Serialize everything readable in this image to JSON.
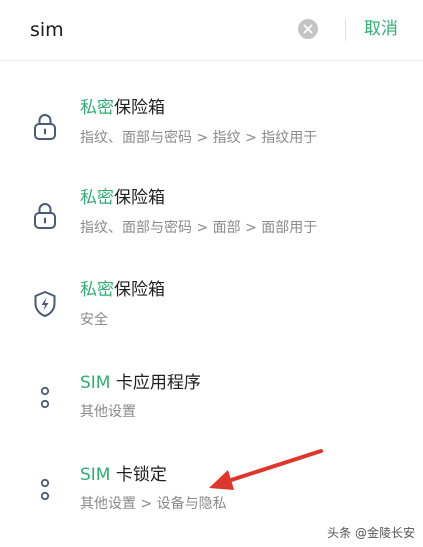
{
  "search": {
    "query": "sim",
    "cancel_label": "取消"
  },
  "results": [
    {
      "title_highlight": "私密",
      "title_rest": "保险箱",
      "subtitle": "指纹、面部与密码 > 指纹 > 指纹用于",
      "icon": "lock-icon"
    },
    {
      "title_highlight": "私密",
      "title_rest": "保险箱",
      "subtitle": "指纹、面部与密码 > 面部 > 面部用于",
      "icon": "lock-icon"
    },
    {
      "title_highlight": "私密",
      "title_rest": "保险箱",
      "subtitle": "安全",
      "icon": "shield-icon"
    },
    {
      "title_highlight": "SIM",
      "title_rest": " 卡应用程序",
      "subtitle": "其他设置",
      "icon": "more-dots-icon"
    },
    {
      "title_highlight": "SIM",
      "title_rest": " 卡锁定",
      "subtitle": "其他设置 > 设备与隐私",
      "icon": "more-dots-icon"
    }
  ],
  "watermark": "头条 @金陵长安",
  "colors": {
    "accent": "#2fae73",
    "icon_stroke": "#4a5a78",
    "annotation_arrow": "#e0352b"
  }
}
